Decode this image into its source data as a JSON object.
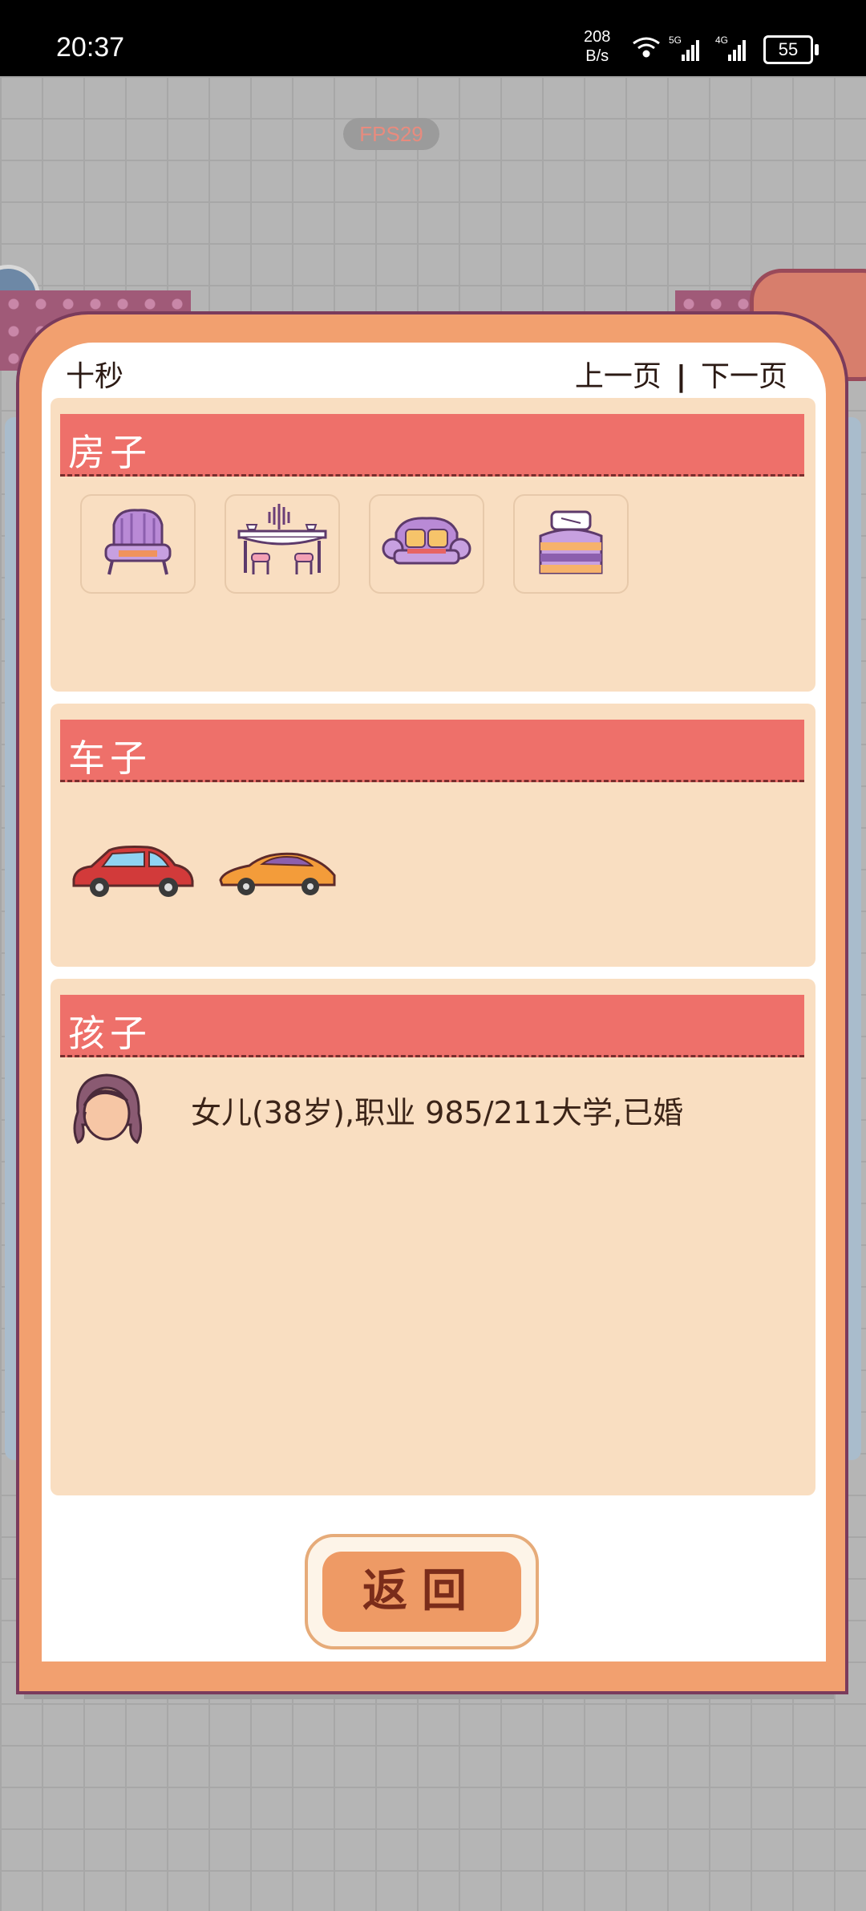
{
  "status_bar": {
    "time": "20:37",
    "net_speed_value": "208",
    "net_speed_unit": "B/s",
    "battery": "55"
  },
  "background": {
    "fps": "FPS29"
  },
  "modal": {
    "nickname": "十秒",
    "prev_page": "上一页",
    "separator": "|",
    "next_page": "下一页",
    "sections": {
      "house": {
        "title": "房子",
        "items": [
          "armchair-icon",
          "dining-table-icon",
          "sofa-icon",
          "bed-icon"
        ]
      },
      "car": {
        "title": "车子",
        "items": [
          "red-car-icon",
          "orange-sports-car-icon"
        ]
      },
      "child": {
        "title": "孩子",
        "description": "女儿(38岁),职业 985/211大学,已婚"
      }
    },
    "back_button": "返回"
  },
  "colors": {
    "modal_frame": "#f2a06f",
    "section_bg": "#f9dec1",
    "section_header": "#ee706a",
    "button": "#ee9a65"
  }
}
